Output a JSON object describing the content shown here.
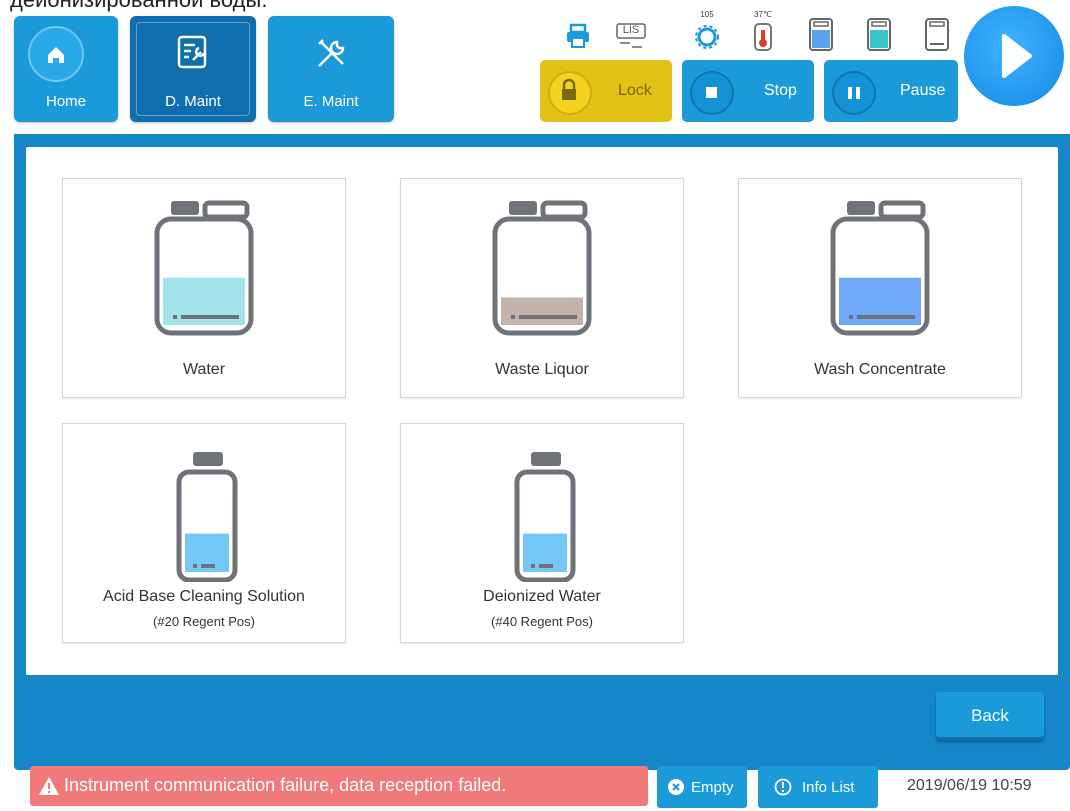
{
  "caption": "деионизированной воды.",
  "nav": {
    "home_label": "Home",
    "dmaint_label": "D. Maint",
    "emaint_label": "E. Maint"
  },
  "status_icons": {
    "lis_label": "LIS",
    "counter_value": "105",
    "temperature_value": "37℃"
  },
  "controls": {
    "lock_label": "Lock",
    "stop_label": "Stop",
    "pause_label": "Pause"
  },
  "cards": [
    {
      "name": "Water",
      "sub": "",
      "fill_fraction": 0.55,
      "fill_color": "#a3e4ea",
      "shape": "jug"
    },
    {
      "name": "Waste Liquor",
      "sub": "",
      "fill_fraction": 0.32,
      "fill_color": "#c4b3ab",
      "shape": "jug"
    },
    {
      "name": "Wash Concentrate",
      "sub": "",
      "fill_fraction": 0.55,
      "fill_color": "#6ea8f6",
      "shape": "jug"
    },
    {
      "name": "Acid Base Cleaning Solution",
      "sub": "(#20 Regent Pos)",
      "fill_fraction": 0.48,
      "fill_color": "#74c6f4",
      "shape": "bottle"
    },
    {
      "name": "Deionized Water",
      "sub": "(#40 Regent Pos)",
      "fill_fraction": 0.48,
      "fill_color": "#74c6f4",
      "shape": "bottle"
    }
  ],
  "back_label": "Back",
  "status": {
    "alert_text": "Instrument communication failure, data reception failed.",
    "empty_label": "Empty",
    "info_label": "Info List",
    "datetime": "2019/06/19 10:59"
  },
  "colors": {
    "accent_blue": "#1a9ad8",
    "frame_blue": "#1587c8",
    "lock_yellow": "#e2c315",
    "alert_red": "#f07a7a"
  }
}
